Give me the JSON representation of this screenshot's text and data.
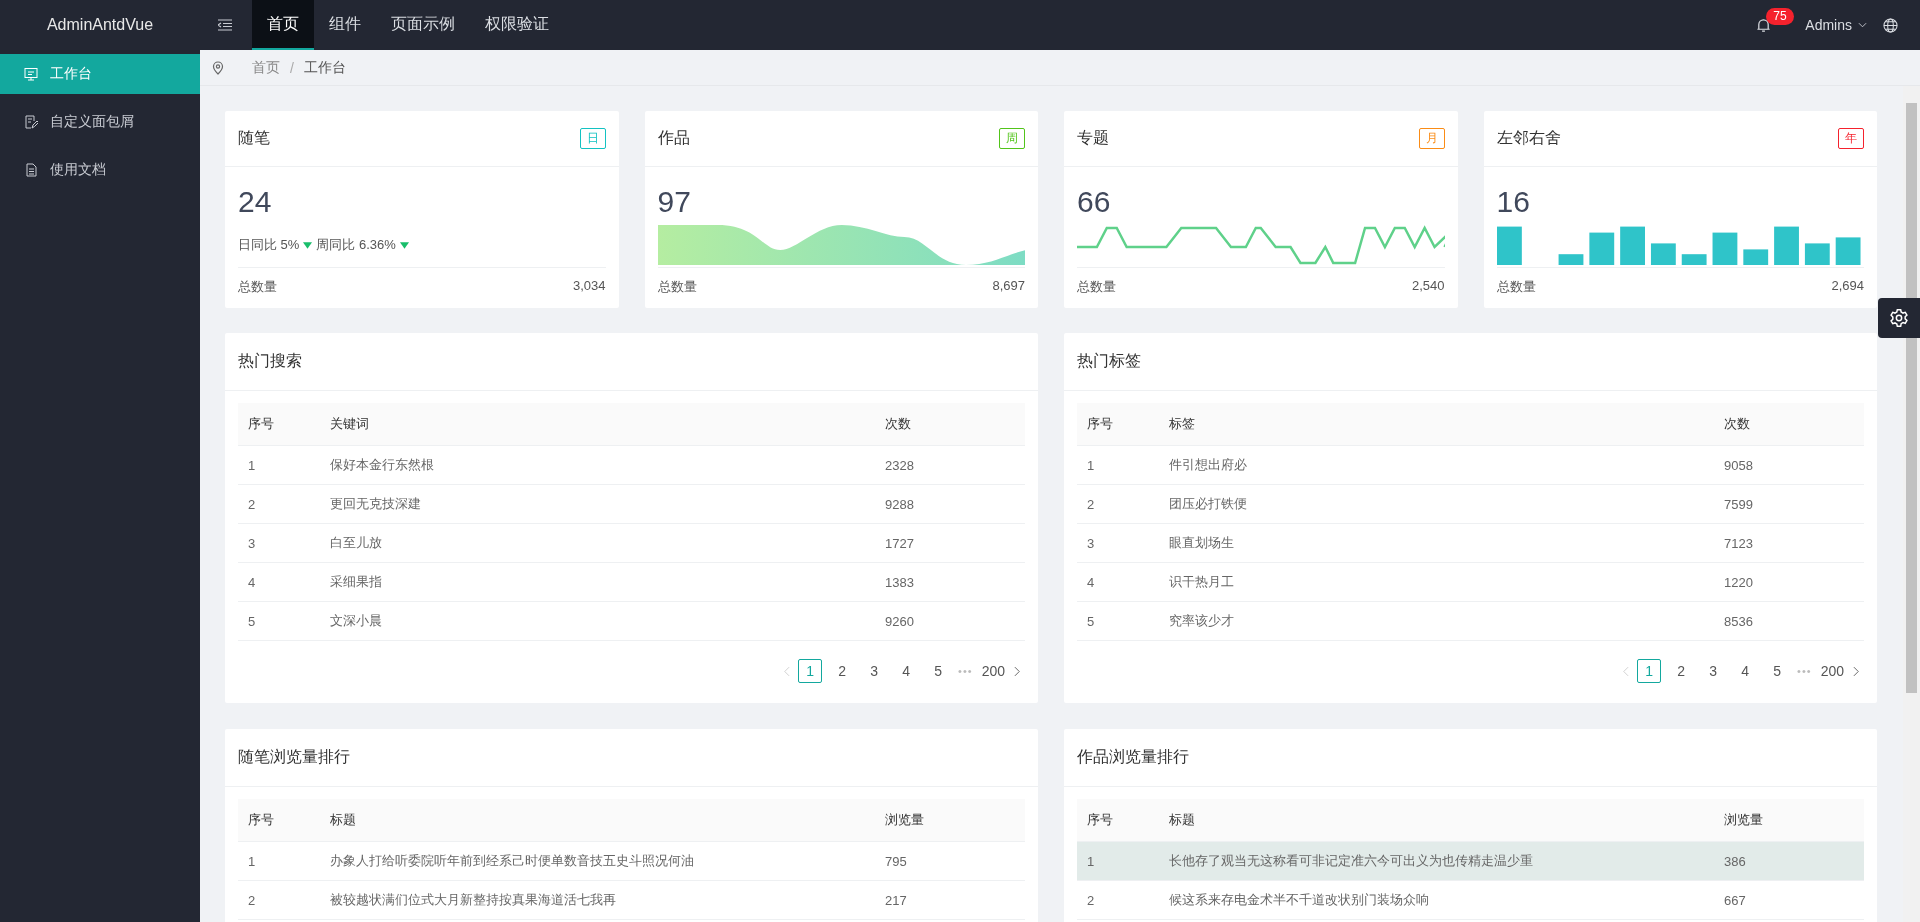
{
  "header": {
    "logo": "AdminAntdVue",
    "nav": [
      {
        "label": "首页",
        "selected": true
      },
      {
        "label": "组件",
        "selected": false
      },
      {
        "label": "页面示例",
        "selected": false
      },
      {
        "label": "权限验证",
        "selected": false
      }
    ],
    "badge": "75",
    "user": "Admins"
  },
  "sidebar": {
    "items": [
      {
        "label": "工作台",
        "selected": true,
        "kind": "monitor"
      },
      {
        "label": "自定义面包屑",
        "selected": false,
        "kind": "edit"
      },
      {
        "label": "使用文档",
        "selected": false,
        "kind": "doc"
      }
    ]
  },
  "breadcrumb": [
    "首页",
    "工作台"
  ],
  "breadcrumb_separator": "/",
  "stat_cards": [
    {
      "title": "随笔",
      "tag": "日",
      "color": "#13c2c2",
      "value": "24",
      "kind": "trend",
      "trends": [
        {
          "label": "日同比",
          "value": "5%"
        },
        {
          "label": "周同比",
          "value": "6.36%"
        }
      ],
      "footer_label": "总数量",
      "footer_value": "3,034"
    },
    {
      "title": "作品",
      "tag": "周",
      "color": "#52c41a",
      "value": "97",
      "kind": "area",
      "footer_label": "总数量",
      "footer_value": "8,697"
    },
    {
      "title": "专题",
      "tag": "月",
      "color": "#fa8c16",
      "value": "66",
      "kind": "line",
      "footer_label": "总数量",
      "footer_value": "2,540"
    },
    {
      "title": "左邻右舍",
      "tag": "年",
      "color": "#f5222d",
      "value": "16",
      "kind": "bar",
      "footer_label": "总数量",
      "footer_value": "2,694"
    }
  ],
  "tables": [
    {
      "title": "热门搜索",
      "columns": [
        "序号",
        "关键词",
        "次数"
      ],
      "rows": [
        {
          "cells": [
            "1",
            "保好本金行东然根",
            "2328"
          ],
          "selected": false
        },
        {
          "cells": [
            "2",
            "更回无克技深建",
            "9288"
          ],
          "selected": false
        },
        {
          "cells": [
            "3",
            "白至儿放",
            "1727"
          ],
          "selected": false
        },
        {
          "cells": [
            "4",
            "采细果指",
            "1383"
          ],
          "selected": false
        },
        {
          "cells": [
            "5",
            "文深小晨",
            "9260"
          ],
          "selected": false
        }
      ],
      "pagination": {
        "pages": [
          {
            "label": "1",
            "selected": true
          },
          {
            "label": "2",
            "selected": false
          },
          {
            "label": "3",
            "selected": false
          },
          {
            "label": "4",
            "selected": false
          },
          {
            "label": "5",
            "selected": false
          }
        ],
        "ellipsis": "•••",
        "last": "200"
      }
    },
    {
      "title": "热门标签",
      "columns": [
        "序号",
        "标签",
        "次数"
      ],
      "rows": [
        {
          "cells": [
            "1",
            "件引想出府必",
            "9058"
          ],
          "selected": false
        },
        {
          "cells": [
            "2",
            "团压必打铁便",
            "7599"
          ],
          "selected": false
        },
        {
          "cells": [
            "3",
            "眼直划场生",
            "7123"
          ],
          "selected": false
        },
        {
          "cells": [
            "4",
            "识干热月工",
            "1220"
          ],
          "selected": false
        },
        {
          "cells": [
            "5",
            "究率该少才",
            "8536"
          ],
          "selected": false
        }
      ],
      "pagination": {
        "pages": [
          {
            "label": "1",
            "selected": true
          },
          {
            "label": "2",
            "selected": false
          },
          {
            "label": "3",
            "selected": false
          },
          {
            "label": "4",
            "selected": false
          },
          {
            "label": "5",
            "selected": false
          }
        ],
        "ellipsis": "•••",
        "last": "200"
      }
    },
    {
      "title": "随笔浏览量排行",
      "columns": [
        "序号",
        "标题",
        "浏览量"
      ],
      "rows": [
        {
          "cells": [
            "1",
            "办象人打给听委院听年前到经系己时便单数音技五史斗照况何油",
            "795"
          ],
          "selected": false
        },
        {
          "cells": [
            "2",
            "被较越状满们位式大月新整持按真果海道活七我再",
            "217"
          ],
          "selected": false
        }
      ]
    },
    {
      "title": "作品浏览量排行",
      "columns": [
        "序号",
        "标题",
        "浏览量"
      ],
      "rows": [
        {
          "cells": [
            "1",
            "长他存了观当无这称看可非记定准六今可出义为也传精走温少重",
            "386"
          ],
          "selected": true
        },
        {
          "cells": [
            "2",
            "候这系来存电金术半不千道改状别门装场众响",
            "667"
          ],
          "selected": false
        }
      ]
    }
  ]
}
